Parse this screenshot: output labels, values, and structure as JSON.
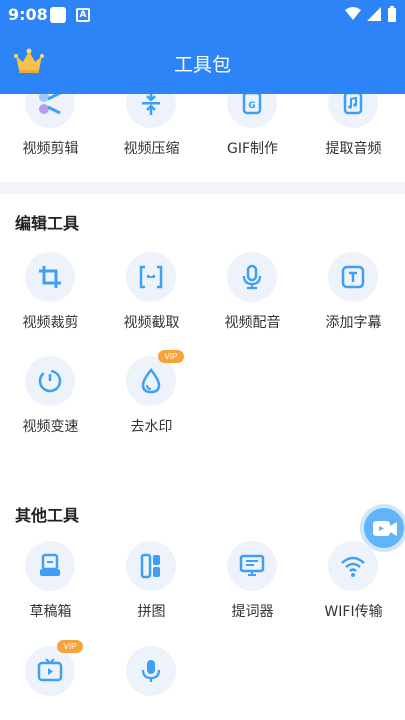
{
  "status": {
    "time": "9:08",
    "notif_letter": "A"
  },
  "header": {
    "title": "工具包"
  },
  "top_row": [
    {
      "label": "视频剪辑",
      "icon": "scissors-icon"
    },
    {
      "label": "视频压缩",
      "icon": "compress-icon"
    },
    {
      "label": "GIF制作",
      "icon": "gif-icon"
    },
    {
      "label": "提取音频",
      "icon": "music-icon"
    }
  ],
  "edit_tools": {
    "title": "编辑工具",
    "items": [
      {
        "label": "视频裁剪",
        "icon": "crop-icon"
      },
      {
        "label": "视频截取",
        "icon": "trim-icon"
      },
      {
        "label": "视频配音",
        "icon": "microphone-icon"
      },
      {
        "label": "添加字幕",
        "icon": "subtitle-icon"
      },
      {
        "label": "视频变速",
        "icon": "speed-icon"
      },
      {
        "label": "去水印",
        "icon": "watermark-drop-icon",
        "badge": "VIP"
      }
    ]
  },
  "other_tools": {
    "title": "其他工具",
    "items": [
      {
        "label": "草稿箱",
        "icon": "drafts-icon"
      },
      {
        "label": "拼图",
        "icon": "collage-icon"
      },
      {
        "label": "提词器",
        "icon": "teleprompter-icon"
      },
      {
        "label": "WIFI传输",
        "icon": "wifi-icon"
      },
      {
        "label": "",
        "icon": "tv-play-icon",
        "badge": "VIP"
      },
      {
        "label": "",
        "icon": "microphone-icon"
      }
    ]
  },
  "colors": {
    "primary": "#2d84f7",
    "icon_blue": "#3ea0f4",
    "vip": "#f6a33c"
  }
}
